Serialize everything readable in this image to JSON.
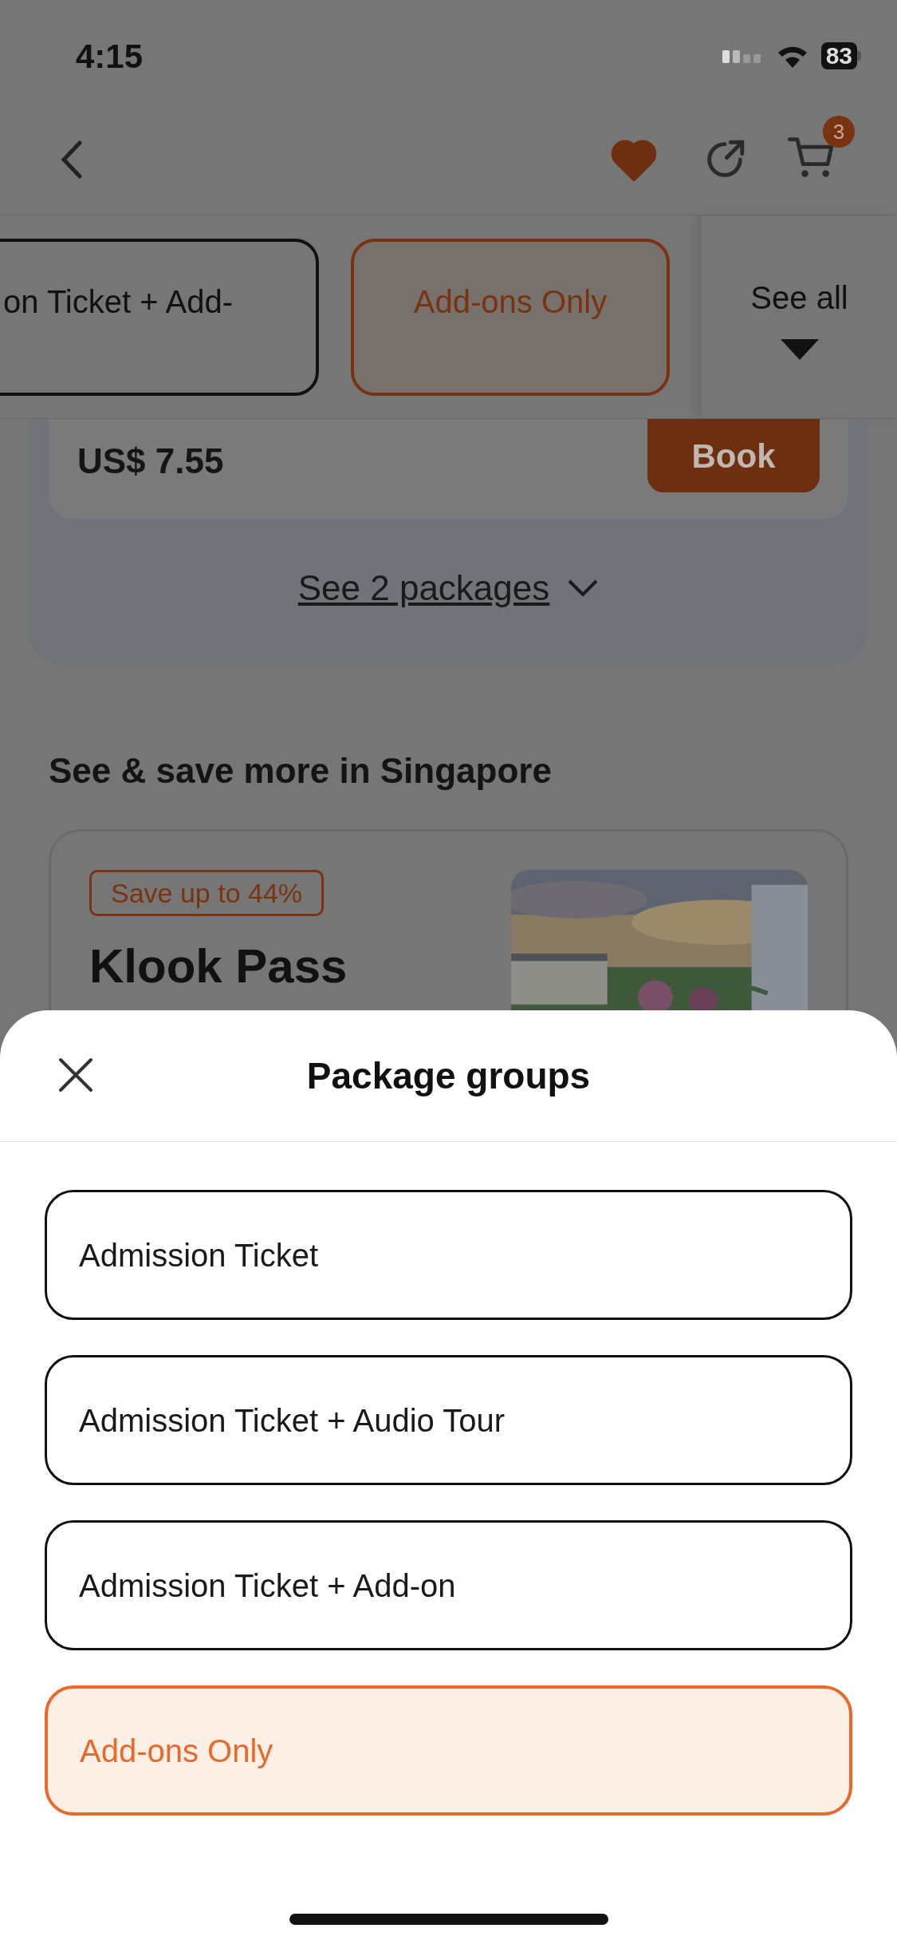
{
  "status_bar": {
    "time": "4:15",
    "battery": "83"
  },
  "nav": {
    "favorited": true,
    "cart_count": "3"
  },
  "tabs": [
    {
      "label": "on Ticket + Add-",
      "selected": false
    },
    {
      "label": "Add-ons Only",
      "selected": true
    }
  ],
  "see_all": "See all",
  "package": {
    "price": "US$ 7.55",
    "button": "Book",
    "see_more": "See 2 packages"
  },
  "section_title": "See & save more in Singapore",
  "promo": {
    "badge": "Save up to 44%",
    "title": "Klook Pass"
  },
  "sheet": {
    "title": "Package groups",
    "options": [
      {
        "label": "Admission Ticket",
        "selected": false
      },
      {
        "label": "Admission Ticket + Audio Tour",
        "selected": false
      },
      {
        "label": "Admission Ticket + Add-on",
        "selected": false
      },
      {
        "label": "Add-ons Only",
        "selected": true
      }
    ]
  }
}
